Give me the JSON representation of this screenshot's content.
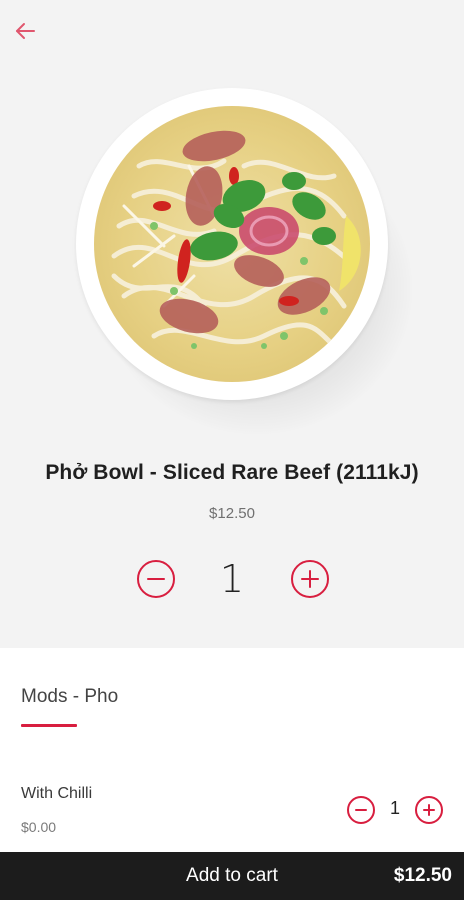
{
  "colors": {
    "accent": "#d81e3f",
    "hero_bg": "#f3f3f3",
    "cart_bar": "#1c1c1c"
  },
  "header": {
    "back_icon": "arrow-left-icon"
  },
  "product": {
    "image": "pho-bowl-photo",
    "title": "Phở Bowl - Sliced Rare Beef (2111kJ)",
    "price": "$12.50",
    "quantity": "1"
  },
  "mods": {
    "tab_label": "Mods - Pho",
    "options": [
      {
        "name": "With Chilli",
        "price": "$0.00",
        "quantity": "1"
      }
    ]
  },
  "cart": {
    "label": "Add to cart",
    "total": "$12.50"
  }
}
